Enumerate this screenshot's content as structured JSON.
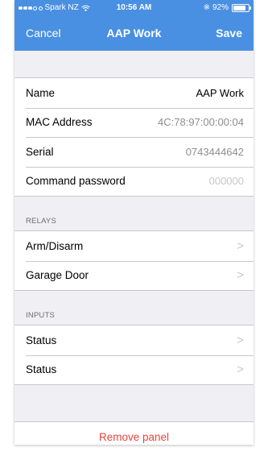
{
  "status_bar": {
    "carrier": "Spark NZ",
    "time": "10:56 AM",
    "battery": "92%",
    "battery_level": 0.92
  },
  "nav": {
    "cancel_label": "Cancel",
    "title": "AAP Work",
    "save_label": "Save"
  },
  "details": [
    {
      "label": "Name",
      "value": "AAP Work",
      "value_color": "#000000"
    },
    {
      "label": "MAC Address",
      "value": "4C:78:97:00:00:04",
      "value_color": "#8e8e93"
    },
    {
      "label": "Serial",
      "value": "0743444642",
      "value_color": "#8e8e93"
    },
    {
      "label": "Command password",
      "value": "000000",
      "value_color": "#c7c7cc"
    }
  ],
  "relays": {
    "header": "RELAYS",
    "items": [
      {
        "label": "Arm/Disarm",
        "chevron": ">"
      },
      {
        "label": "Garage Door",
        "chevron": ">"
      }
    ]
  },
  "inputs": {
    "header": "INPUTS",
    "items": [
      {
        "label": "Status",
        "chevron": ">"
      },
      {
        "label": "Status",
        "chevron": ">"
      }
    ]
  },
  "remove_label": "Remove panel",
  "colors": {
    "nav_bg": "#4a90e2",
    "page_bg": "#efeff4",
    "destructive": "#e8453c"
  }
}
